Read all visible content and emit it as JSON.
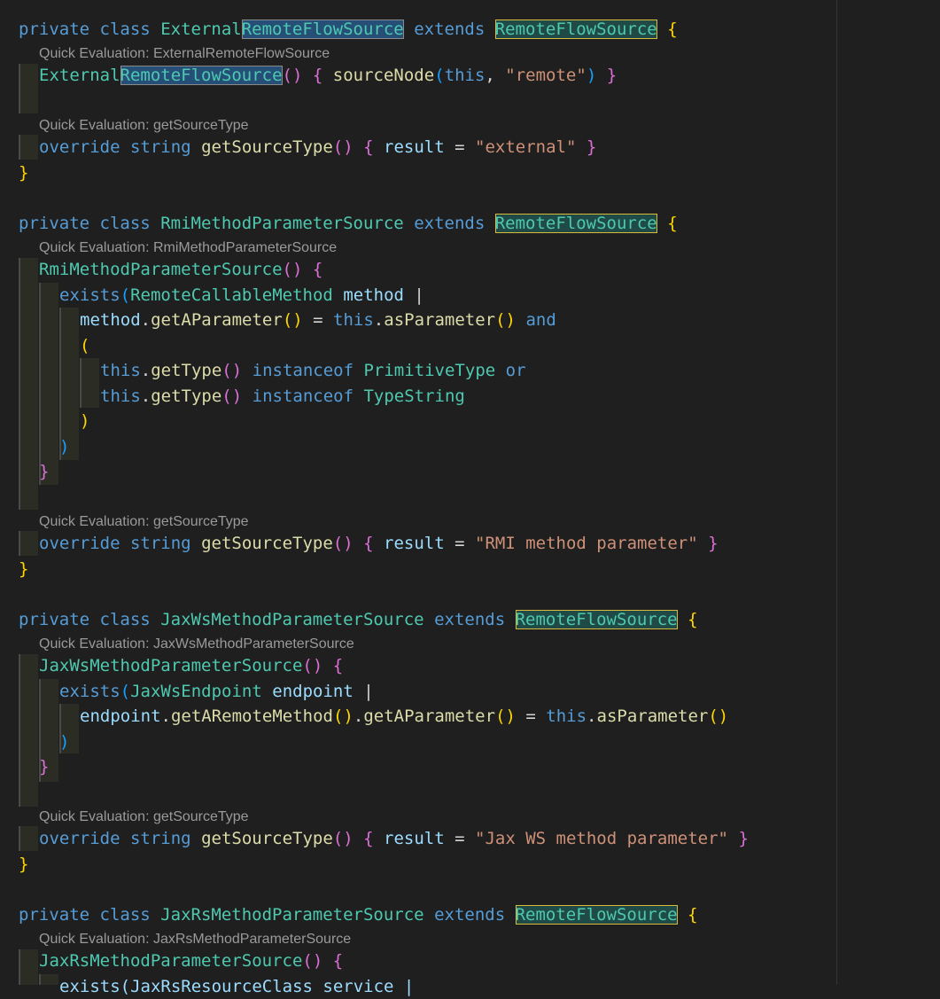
{
  "lenses": {
    "l1": "Quick Evaluation: ExternalRemoteFlowSource",
    "l2": "Quick Evaluation: getSourceType",
    "l3": "Quick Evaluation: RmiMethodParameterSource",
    "l4": "Quick Evaluation: getSourceType",
    "l5": "Quick Evaluation: JaxWsMethodParameterSource",
    "l6": "Quick Evaluation: getSourceType",
    "l7": "Quick Evaluation: JaxRsMethodParameterSource"
  },
  "tokens": {
    "private": "private",
    "class": "class",
    "extends": "extends",
    "override": "override",
    "string": "string",
    "result": "result",
    "this": "this",
    "and": "and",
    "or": "or",
    "instanceof": "instanceof",
    "exists": "exists",
    "External": "External",
    "RemoteFlowSource": "RemoteFlowSource",
    "sourceNode": "sourceNode",
    "remote": "\"remote\"",
    "getSourceType": "getSourceType",
    "external": "\"external\"",
    "RmiMethodParameterSource": "RmiMethodParameterSource",
    "RemoteCallableMethod": "RemoteCallableMethod",
    "method": "method",
    "getAParameter": "getAParameter",
    "asParameter": "asParameter",
    "getType": "getType",
    "PrimitiveType": "PrimitiveType",
    "TypeString": "TypeString",
    "rmi_str": "\"RMI method parameter\"",
    "JaxWsMethodParameterSource": "JaxWsMethodParameterSource",
    "JaxWsEndpoint": "JaxWsEndpoint",
    "endpoint": "endpoint",
    "getARemoteMethod": "getARemoteMethod",
    "jaxws_str": "\"Jax WS method parameter\"",
    "JaxRsMethodParameterSource": "JaxRsMethodParameterSource",
    "partial_last": "exists(JaxRsResourceClass service |"
  }
}
